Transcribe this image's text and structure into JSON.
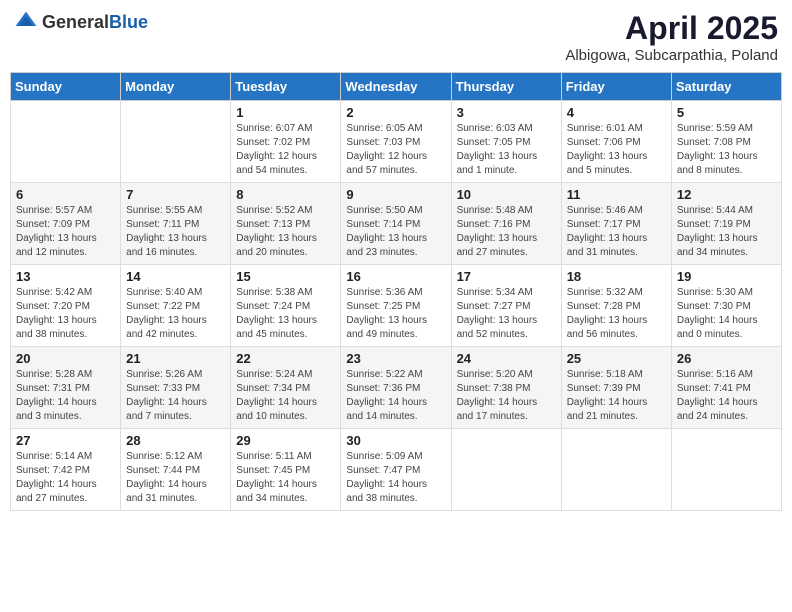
{
  "header": {
    "logo_general": "General",
    "logo_blue": "Blue",
    "title": "April 2025",
    "subtitle": "Albigowa, Subcarpathia, Poland"
  },
  "weekdays": [
    "Sunday",
    "Monday",
    "Tuesday",
    "Wednesday",
    "Thursday",
    "Friday",
    "Saturday"
  ],
  "weeks": [
    [
      {
        "day": "",
        "sunrise": "",
        "sunset": "",
        "daylight": ""
      },
      {
        "day": "",
        "sunrise": "",
        "sunset": "",
        "daylight": ""
      },
      {
        "day": "1",
        "sunrise": "Sunrise: 6:07 AM",
        "sunset": "Sunset: 7:02 PM",
        "daylight": "Daylight: 12 hours and 54 minutes."
      },
      {
        "day": "2",
        "sunrise": "Sunrise: 6:05 AM",
        "sunset": "Sunset: 7:03 PM",
        "daylight": "Daylight: 12 hours and 57 minutes."
      },
      {
        "day": "3",
        "sunrise": "Sunrise: 6:03 AM",
        "sunset": "Sunset: 7:05 PM",
        "daylight": "Daylight: 13 hours and 1 minute."
      },
      {
        "day": "4",
        "sunrise": "Sunrise: 6:01 AM",
        "sunset": "Sunset: 7:06 PM",
        "daylight": "Daylight: 13 hours and 5 minutes."
      },
      {
        "day": "5",
        "sunrise": "Sunrise: 5:59 AM",
        "sunset": "Sunset: 7:08 PM",
        "daylight": "Daylight: 13 hours and 8 minutes."
      }
    ],
    [
      {
        "day": "6",
        "sunrise": "Sunrise: 5:57 AM",
        "sunset": "Sunset: 7:09 PM",
        "daylight": "Daylight: 13 hours and 12 minutes."
      },
      {
        "day": "7",
        "sunrise": "Sunrise: 5:55 AM",
        "sunset": "Sunset: 7:11 PM",
        "daylight": "Daylight: 13 hours and 16 minutes."
      },
      {
        "day": "8",
        "sunrise": "Sunrise: 5:52 AM",
        "sunset": "Sunset: 7:13 PM",
        "daylight": "Daylight: 13 hours and 20 minutes."
      },
      {
        "day": "9",
        "sunrise": "Sunrise: 5:50 AM",
        "sunset": "Sunset: 7:14 PM",
        "daylight": "Daylight: 13 hours and 23 minutes."
      },
      {
        "day": "10",
        "sunrise": "Sunrise: 5:48 AM",
        "sunset": "Sunset: 7:16 PM",
        "daylight": "Daylight: 13 hours and 27 minutes."
      },
      {
        "day": "11",
        "sunrise": "Sunrise: 5:46 AM",
        "sunset": "Sunset: 7:17 PM",
        "daylight": "Daylight: 13 hours and 31 minutes."
      },
      {
        "day": "12",
        "sunrise": "Sunrise: 5:44 AM",
        "sunset": "Sunset: 7:19 PM",
        "daylight": "Daylight: 13 hours and 34 minutes."
      }
    ],
    [
      {
        "day": "13",
        "sunrise": "Sunrise: 5:42 AM",
        "sunset": "Sunset: 7:20 PM",
        "daylight": "Daylight: 13 hours and 38 minutes."
      },
      {
        "day": "14",
        "sunrise": "Sunrise: 5:40 AM",
        "sunset": "Sunset: 7:22 PM",
        "daylight": "Daylight: 13 hours and 42 minutes."
      },
      {
        "day": "15",
        "sunrise": "Sunrise: 5:38 AM",
        "sunset": "Sunset: 7:24 PM",
        "daylight": "Daylight: 13 hours and 45 minutes."
      },
      {
        "day": "16",
        "sunrise": "Sunrise: 5:36 AM",
        "sunset": "Sunset: 7:25 PM",
        "daylight": "Daylight: 13 hours and 49 minutes."
      },
      {
        "day": "17",
        "sunrise": "Sunrise: 5:34 AM",
        "sunset": "Sunset: 7:27 PM",
        "daylight": "Daylight: 13 hours and 52 minutes."
      },
      {
        "day": "18",
        "sunrise": "Sunrise: 5:32 AM",
        "sunset": "Sunset: 7:28 PM",
        "daylight": "Daylight: 13 hours and 56 minutes."
      },
      {
        "day": "19",
        "sunrise": "Sunrise: 5:30 AM",
        "sunset": "Sunset: 7:30 PM",
        "daylight": "Daylight: 14 hours and 0 minutes."
      }
    ],
    [
      {
        "day": "20",
        "sunrise": "Sunrise: 5:28 AM",
        "sunset": "Sunset: 7:31 PM",
        "daylight": "Daylight: 14 hours and 3 minutes."
      },
      {
        "day": "21",
        "sunrise": "Sunrise: 5:26 AM",
        "sunset": "Sunset: 7:33 PM",
        "daylight": "Daylight: 14 hours and 7 minutes."
      },
      {
        "day": "22",
        "sunrise": "Sunrise: 5:24 AM",
        "sunset": "Sunset: 7:34 PM",
        "daylight": "Daylight: 14 hours and 10 minutes."
      },
      {
        "day": "23",
        "sunrise": "Sunrise: 5:22 AM",
        "sunset": "Sunset: 7:36 PM",
        "daylight": "Daylight: 14 hours and 14 minutes."
      },
      {
        "day": "24",
        "sunrise": "Sunrise: 5:20 AM",
        "sunset": "Sunset: 7:38 PM",
        "daylight": "Daylight: 14 hours and 17 minutes."
      },
      {
        "day": "25",
        "sunrise": "Sunrise: 5:18 AM",
        "sunset": "Sunset: 7:39 PM",
        "daylight": "Daylight: 14 hours and 21 minutes."
      },
      {
        "day": "26",
        "sunrise": "Sunrise: 5:16 AM",
        "sunset": "Sunset: 7:41 PM",
        "daylight": "Daylight: 14 hours and 24 minutes."
      }
    ],
    [
      {
        "day": "27",
        "sunrise": "Sunrise: 5:14 AM",
        "sunset": "Sunset: 7:42 PM",
        "daylight": "Daylight: 14 hours and 27 minutes."
      },
      {
        "day": "28",
        "sunrise": "Sunrise: 5:12 AM",
        "sunset": "Sunset: 7:44 PM",
        "daylight": "Daylight: 14 hours and 31 minutes."
      },
      {
        "day": "29",
        "sunrise": "Sunrise: 5:11 AM",
        "sunset": "Sunset: 7:45 PM",
        "daylight": "Daylight: 14 hours and 34 minutes."
      },
      {
        "day": "30",
        "sunrise": "Sunrise: 5:09 AM",
        "sunset": "Sunset: 7:47 PM",
        "daylight": "Daylight: 14 hours and 38 minutes."
      },
      {
        "day": "",
        "sunrise": "",
        "sunset": "",
        "daylight": ""
      },
      {
        "day": "",
        "sunrise": "",
        "sunset": "",
        "daylight": ""
      },
      {
        "day": "",
        "sunrise": "",
        "sunset": "",
        "daylight": ""
      }
    ]
  ]
}
